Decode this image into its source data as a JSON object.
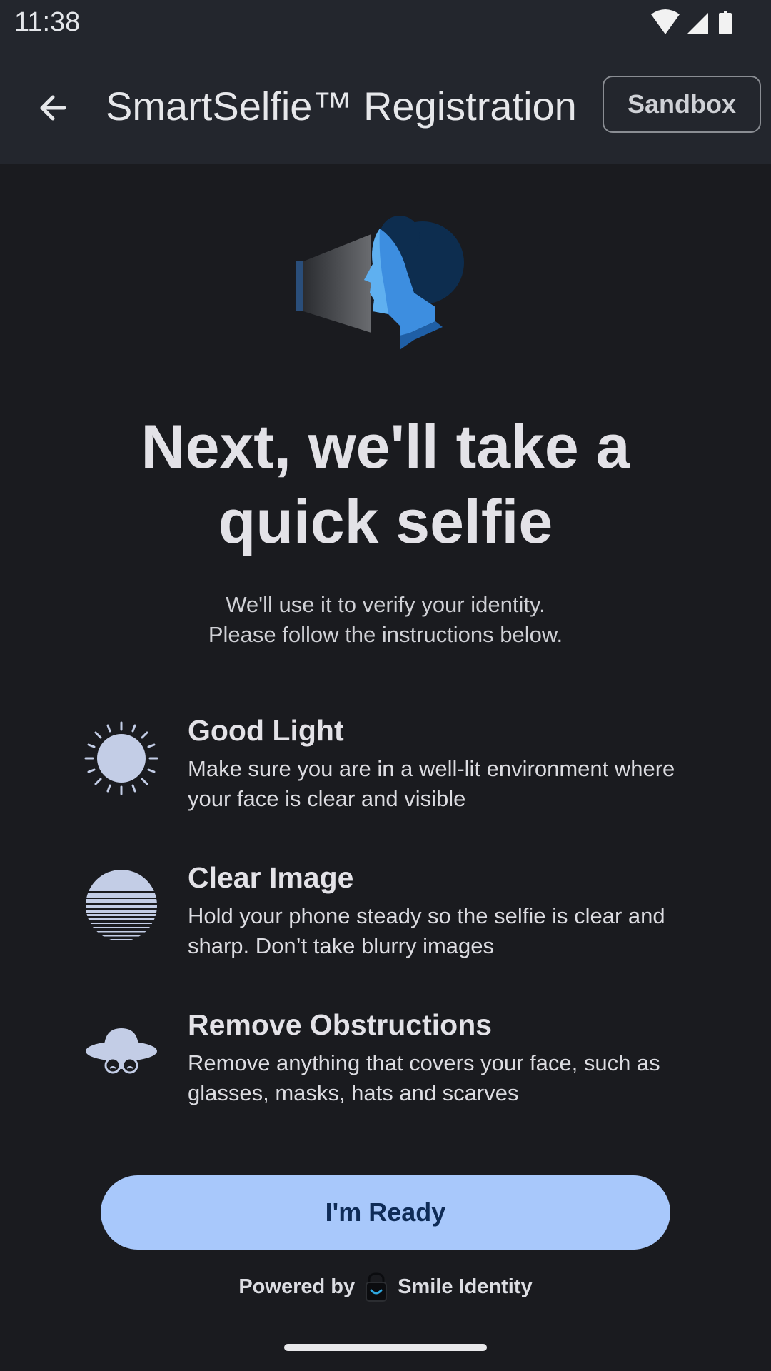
{
  "status_bar": {
    "time": "11:38",
    "icons": [
      "wifi-icon",
      "signal-icon",
      "battery-icon"
    ]
  },
  "app_bar": {
    "back_icon": "arrow-back-icon",
    "title": "SmartSelfie™ Registration",
    "sandbox_label": "Sandbox"
  },
  "main": {
    "headline": "Next, we'll take a quick selfie",
    "subtitle_line1": "We'll use it to verify your identity.",
    "subtitle_line2": "Please follow the instructions below.",
    "tips": [
      {
        "icon": "sun-icon",
        "title": "Good Light",
        "description": "Make sure you are in a well-lit environment where your face is clear and visible"
      },
      {
        "icon": "blurred-circle-icon",
        "title": "Clear Image",
        "description": "Hold your phone steady so the selfie is clear and sharp. Don’t take blurry images"
      },
      {
        "icon": "hat-glasses-icon",
        "title": "Remove Obstructions",
        "description": "Remove anything that covers your face, such as glasses, masks, hats and scarves"
      }
    ],
    "ready_button": "I'm Ready",
    "powered_by": "Powered by",
    "brand": "Smile Identity"
  },
  "colors": {
    "background": "#1a1b1f",
    "app_bar": "#23262d",
    "button": "#a8c8fb",
    "button_text": "#0f2c57",
    "icon": "#c3cde6"
  }
}
